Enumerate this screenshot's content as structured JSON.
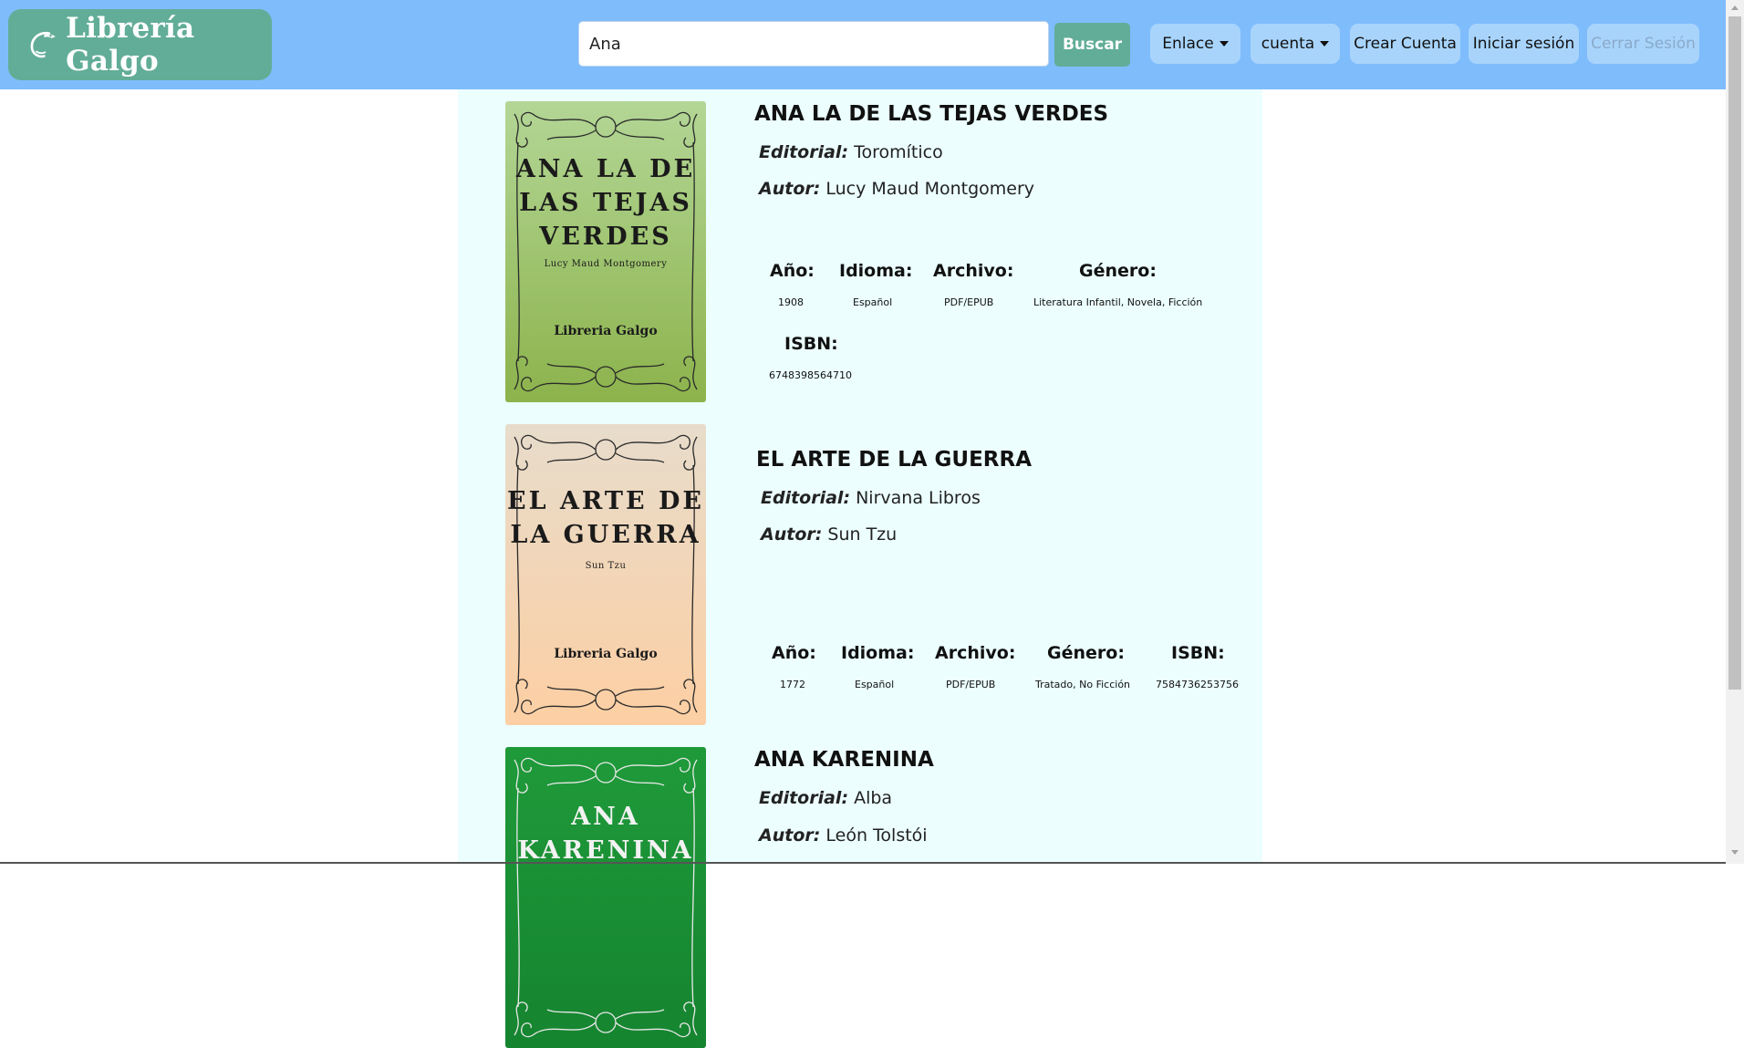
{
  "brand": {
    "name": "Librería Galgo",
    "logo_icon": "greyhound-logo-icon"
  },
  "search": {
    "value": "Ana",
    "placeholder": "",
    "button_label": "Buscar"
  },
  "nav": {
    "enlace_label": "Enlace",
    "cuenta_label": "cuenta",
    "crear_label": "Crear Cuenta",
    "iniciar_label": "Iniciar sesión",
    "cerrar_label": "Cerrar Sesión"
  },
  "labels": {
    "editorial": "Editorial:",
    "autor": "Autor:",
    "anio": "Año:",
    "idioma": "Idioma:",
    "archivo": "Archivo:",
    "genero": "Género:",
    "isbn": "ISBN:"
  },
  "colors": {
    "navbar": "#7fbcfc",
    "brand": "#62ad97",
    "content_bg": "#ecfefe"
  },
  "books": [
    {
      "title": "ANA LA DE LAS TEJAS VERDES",
      "editorial": "Toromítico",
      "autor": "Lucy Maud Montgomery",
      "anio": "1908",
      "idioma": "Español",
      "archivo": "PDF/EPUB",
      "genero": "Literatura Infantil, Novela, Ficción",
      "isbn": "6748398564710",
      "cover": {
        "title_lines": [
          "ANA LA DE",
          "LAS TEJAS",
          "VERDES"
        ],
        "author": "Lucy Maud Montgomery",
        "publisher": "Libreria Galgo",
        "bg_top": "#b3d696",
        "bg_bottom": "#8cb34c",
        "text_color": "#1a1a1a"
      }
    },
    {
      "title": "EL ARTE DE LA GUERRA",
      "editorial": "Nirvana Libros",
      "autor": "Sun Tzu",
      "anio": "1772",
      "idioma": "Español",
      "archivo": "PDF/EPUB",
      "genero": "Tratado, No Ficción",
      "isbn": "7584736253756",
      "cover": {
        "title_lines": [
          "EL ARTE DE",
          "LA GUERRA"
        ],
        "author": "Sun Tzu",
        "publisher": "Libreria Galgo",
        "bg_top": "#e7dccb",
        "bg_bottom": "#fdcfa3",
        "text_color": "#1a1a1a"
      }
    },
    {
      "title": "ANA KARENINA",
      "editorial": "Alba",
      "autor": "León Tolstói",
      "cover": {
        "title_lines": [
          "ANA",
          "KARENINA"
        ],
        "bg_top": "#1f9a3a",
        "bg_bottom": "#15842f",
        "text_color": "#f2f2f2"
      }
    }
  ]
}
